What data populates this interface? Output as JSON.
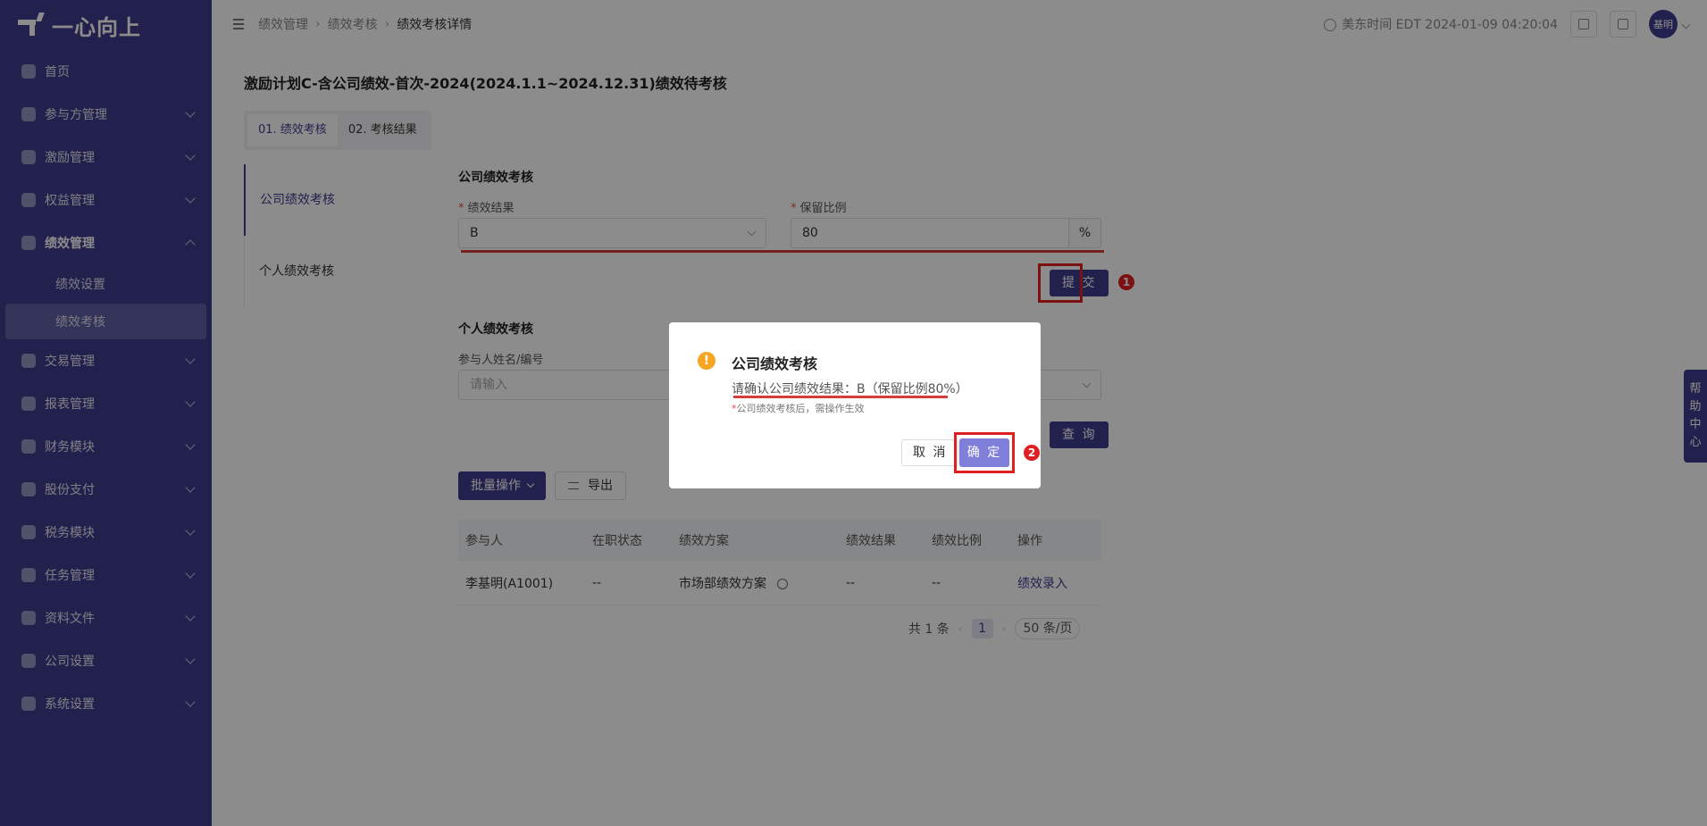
{
  "sidebar": {
    "logo": "一心向上",
    "items": [
      {
        "label": "首页",
        "icon": "home-icon"
      },
      {
        "label": "参与方管理",
        "icon": "users-icon"
      },
      {
        "label": "激励管理",
        "icon": "incentive-icon"
      },
      {
        "label": "权益管理",
        "icon": "equity-icon"
      },
      {
        "label": "绩效管理",
        "icon": "performance-icon"
      },
      {
        "label": "交易管理",
        "icon": "trade-icon"
      },
      {
        "label": "报表管理",
        "icon": "report-icon"
      },
      {
        "label": "财务模块",
        "icon": "finance-icon"
      },
      {
        "label": "股份支付",
        "icon": "share-payment-icon"
      },
      {
        "label": "税务模块",
        "icon": "tax-icon"
      },
      {
        "label": "任务管理",
        "icon": "task-icon"
      },
      {
        "label": "资料文件",
        "icon": "file-icon"
      },
      {
        "label": "公司设置",
        "icon": "company-icon"
      },
      {
        "label": "系统设置",
        "icon": "settings-icon"
      }
    ],
    "sub_items": [
      "绩效设置",
      "绩效考核"
    ]
  },
  "header": {
    "breadcrumb": [
      "绩效管理",
      "绩效考核",
      "绩效考核详情"
    ],
    "timezone_label": "美东时间",
    "datetime": "EDT 2024-01-09 04:20:04",
    "avatar_text": "基明"
  },
  "page": {
    "title": "激励计划C-含公司绩效-首次-2024(2024.1.1~2024.12.31)绩效待考核",
    "tabs": [
      "01. 绩效考核",
      "02. 考核结果"
    ],
    "side_tabs": [
      "公司绩效考核",
      "个人绩效考核"
    ]
  },
  "company": {
    "section_title": "公司绩效考核",
    "result_label": "绩效结果",
    "result_value": "B",
    "ratio_label": "保留比例",
    "ratio_value": "80",
    "ratio_suffix": "%",
    "submit_label": "提 交",
    "badge": "1"
  },
  "personal": {
    "section_title": "个人绩效考核",
    "search_label": "参与人姓名/编号",
    "search_placeholder": "请输入",
    "query_label": "查 询",
    "bulk_label": "批量操作",
    "export_label": "导出"
  },
  "table": {
    "headers": [
      "参与人",
      "在职状态",
      "绩效方案",
      "绩效结果",
      "绩效比例",
      "操作"
    ],
    "rows": [
      {
        "participant": "李基明(A1001)",
        "status": "--",
        "plan": "市场部绩效方案",
        "result": "--",
        "ratio": "--",
        "action": "绩效录入"
      }
    ]
  },
  "pagination": {
    "total": "共 1 条",
    "page": "1",
    "page_size": "50 条/页"
  },
  "help": [
    "帮",
    "助",
    "中",
    "心"
  ],
  "modal": {
    "title": "公司绩效考核",
    "message": "请确认公司绩效结果：B（保留比例80%）",
    "note_mark": "*",
    "note": "公司绩效考核后，需操作生效",
    "cancel_label": "取 消",
    "ok_label": "确 定",
    "badge": "2"
  },
  "colors": {
    "brand": "#3f3d8e",
    "annotation": "#e02020",
    "warning": "#f6a623"
  }
}
